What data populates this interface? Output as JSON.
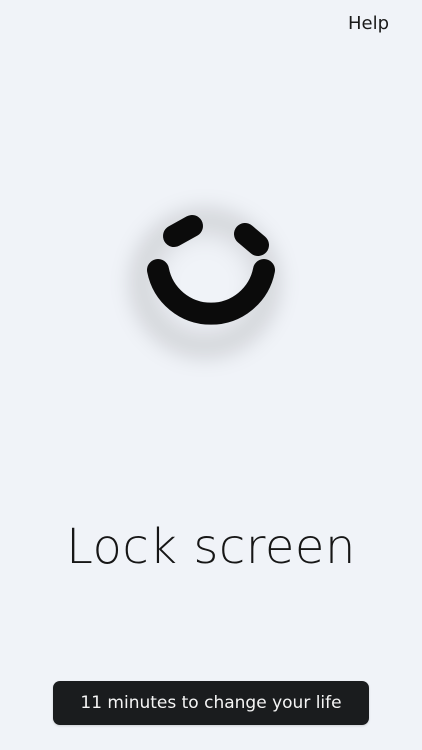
{
  "header": {
    "help_label": "Help"
  },
  "logo": {
    "icon": "smile-logo-icon",
    "color": "#0b0b0b"
  },
  "main": {
    "title": "Lock screen"
  },
  "footer": {
    "cta_label": "11 minutes to change your life",
    "cta_color": "#1a1c1e"
  },
  "colors": {
    "background": "#f0f3f8",
    "text": "#161616"
  }
}
